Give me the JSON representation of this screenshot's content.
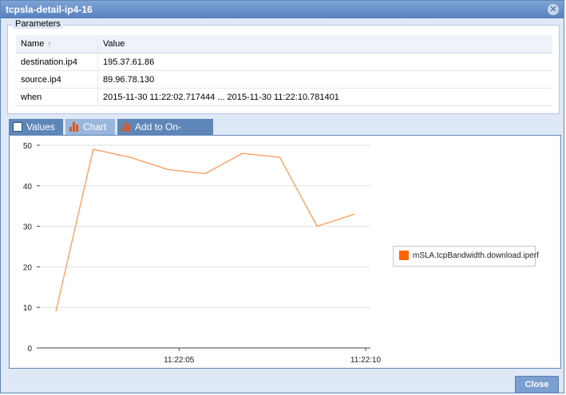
{
  "window": {
    "title": "tcpsla-detail-ip4-16"
  },
  "parameters": {
    "legend": "Parameters",
    "columns": [
      "Name",
      "Value"
    ],
    "rows": [
      [
        "destination.ip4",
        "195.37.61.86"
      ],
      [
        "source.ip4",
        "89.96.78.130"
      ],
      [
        "when",
        "2015-11-30 11:22:02.717444 ... 2015-11-30 11:22:10.781401"
      ]
    ]
  },
  "tabs": [
    {
      "label": "Values",
      "icon": "table-icon"
    },
    {
      "label": "Chart",
      "icon": "bar-chart-icon"
    },
    {
      "label": "Add to On-Demand",
      "icon": "bar-chart-icon"
    }
  ],
  "chart_data": {
    "type": "line",
    "series": [
      {
        "name": "mSLA.tcpBandwidth.download.iperf",
        "color": "#ff9955",
        "x": [
          "11:22:02.717",
          "11:22:03.7",
          "11:22:04.7",
          "11:22:05.7",
          "11:22:06.7",
          "11:22:07.7",
          "11:22:08.7",
          "11:22:09.7",
          "11:22:10.78"
        ],
        "values": [
          9,
          49,
          47,
          44,
          43,
          48,
          47,
          30,
          33
        ]
      }
    ],
    "yticks": [
      "0",
      "10",
      "20",
      "30",
      "40",
      "50"
    ],
    "xticks": [
      "11:22:05",
      "11:22:10"
    ],
    "ylim": [
      0,
      50
    ],
    "grid": true,
    "legend_position": "right"
  },
  "buttons": {
    "close": "Close"
  }
}
